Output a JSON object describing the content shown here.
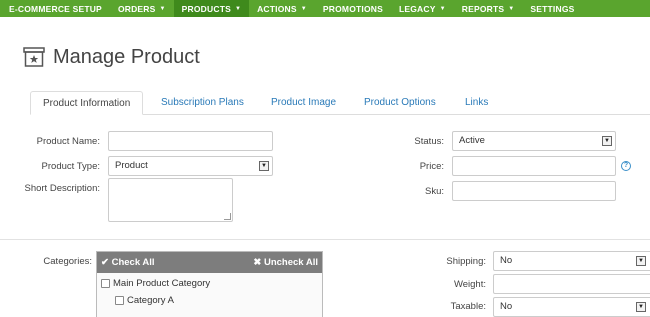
{
  "nav": {
    "items": [
      {
        "label": "E-COMMERCE SETUP",
        "caret": ""
      },
      {
        "label": "ORDERS",
        "caret": "▼"
      },
      {
        "label": "PRODUCTS",
        "caret": "▼"
      },
      {
        "label": "ACTIONS",
        "caret": "▼"
      },
      {
        "label": "PROMOTIONS",
        "caret": ""
      },
      {
        "label": "LEGACY",
        "caret": "▼"
      },
      {
        "label": "REPORTS",
        "caret": "▼"
      },
      {
        "label": "SETTINGS",
        "caret": ""
      }
    ],
    "active_index": 2,
    "bg_color": "#5aa52e"
  },
  "page": {
    "title": "Manage Product",
    "icon": "product-box-icon"
  },
  "tabs": [
    {
      "label": "Product Information"
    },
    {
      "label": "Subscription Plans"
    },
    {
      "label": "Product Image"
    },
    {
      "label": "Product Options"
    },
    {
      "label": "Links"
    }
  ],
  "form": {
    "product_name": {
      "label": "Product Name:",
      "value": ""
    },
    "product_type": {
      "label": "Product Type:",
      "value": "Product"
    },
    "short_description": {
      "label": "Short Description:",
      "value": ""
    },
    "status": {
      "label": "Status:",
      "value": "Active"
    },
    "price": {
      "label": "Price:",
      "value": "",
      "help": "?"
    },
    "sku": {
      "label": "Sku:",
      "value": ""
    },
    "categories": {
      "label": "Categories:",
      "check_all": "✔ Check All",
      "uncheck_all": "✖ Uncheck All",
      "items": [
        {
          "label": "Main Product Category"
        },
        {
          "label": "Category A"
        }
      ]
    },
    "shipping": {
      "label": "Shipping:",
      "value": "No"
    },
    "weight": {
      "label": "Weight:",
      "value": ""
    },
    "taxable": {
      "label": "Taxable:",
      "value": "No"
    }
  }
}
